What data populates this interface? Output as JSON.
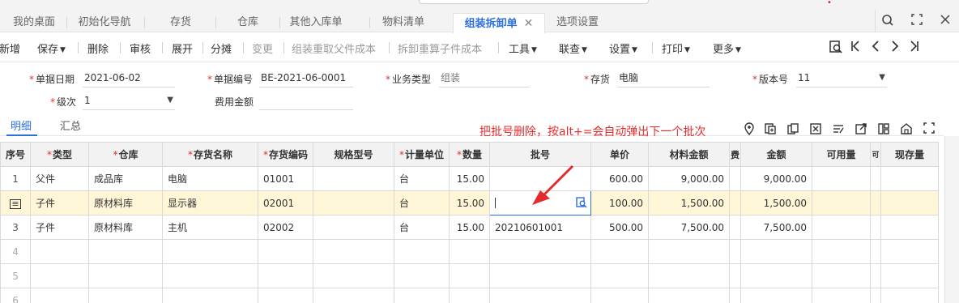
{
  "tabs": [
    {
      "label": "我的桌面",
      "active": false
    },
    {
      "label": "初始化导航",
      "active": false
    },
    {
      "label": "存货",
      "active": false
    },
    {
      "label": "仓库",
      "active": false
    },
    {
      "label": "其他入库单",
      "active": false
    },
    {
      "label": "物料清单",
      "active": false
    },
    {
      "label": "组装拆卸单",
      "active": true
    },
    {
      "label": "选项设置",
      "active": false
    }
  ],
  "window_icons": [
    "search-icon",
    "restore-icon",
    "close-icon"
  ],
  "toolbar": {
    "new": "新增",
    "save": "保存",
    "delete": "删除",
    "audit": "审核",
    "expand": "展开",
    "allocate": "分摊",
    "change": "变更",
    "reparent": "组装重取父件成本",
    "recompute": "拆卸重算子件成本",
    "tools": "工具",
    "link": "联查",
    "settings": "设置",
    "print": "打印",
    "more": "更多"
  },
  "form": {
    "date_label": "单据日期",
    "date_value": "2021-06-02",
    "number_label": "单据编号",
    "number_value": "BE-2021-06-0001",
    "biztype_label": "业务类型",
    "biztype_value": "组装",
    "stock_label": "存货",
    "stock_value": "电脑",
    "version_label": "版本号",
    "version_value": "11",
    "level_label": "级次",
    "level_value": "1",
    "fee_label": "费用金额",
    "fee_value": ""
  },
  "subtabs": {
    "detail": "明细",
    "summary": "汇总"
  },
  "annotation": "把批号删除，按alt+=会自动弹出下一个批次",
  "grid": {
    "headers": [
      "序号",
      "类型",
      "仓库",
      "存货名称",
      "存货编码",
      "规格型号",
      "计量单位",
      "数量",
      "批号",
      "单价",
      "材料金额",
      "费",
      "金额",
      "可用量",
      "可",
      "现存量"
    ],
    "required": [
      false,
      true,
      true,
      true,
      true,
      false,
      true,
      true,
      false,
      false,
      false,
      false,
      false,
      false,
      false,
      false
    ],
    "rows": [
      {
        "seq": "1",
        "type": "父件",
        "warehouse": "成品库",
        "name": "电脑",
        "code": "01001",
        "spec": "",
        "unit": "台",
        "qty": "15.00",
        "batch": "",
        "price": "600.00",
        "material": "9,000.00",
        "fee": "",
        "amount": "9,000.00",
        "avail": "",
        "c": "",
        "stock": ""
      },
      {
        "seq": "",
        "type": "子件",
        "warehouse": "原材料库",
        "name": "显示器",
        "code": "02001",
        "spec": "",
        "unit": "台",
        "qty": "15.00",
        "batch": "",
        "price": "100.00",
        "material": "1,500.00",
        "fee": "",
        "amount": "1,500.00",
        "avail": "",
        "c": "",
        "stock": ""
      },
      {
        "seq": "3",
        "type": "子件",
        "warehouse": "原材料库",
        "name": "主机",
        "code": "02002",
        "spec": "",
        "unit": "台",
        "qty": "15.00",
        "batch": "20210601001",
        "price": "500.00",
        "material": "7,500.00",
        "fee": "",
        "amount": "7,500.00",
        "avail": "",
        "c": "",
        "stock": ""
      },
      {
        "seq": "4"
      },
      {
        "seq": "5"
      },
      {
        "seq": "6"
      }
    ]
  },
  "colors": {
    "accent": "#2e6fe0",
    "annotation": "#e52c2c",
    "selected_row": "#fff6d8"
  }
}
